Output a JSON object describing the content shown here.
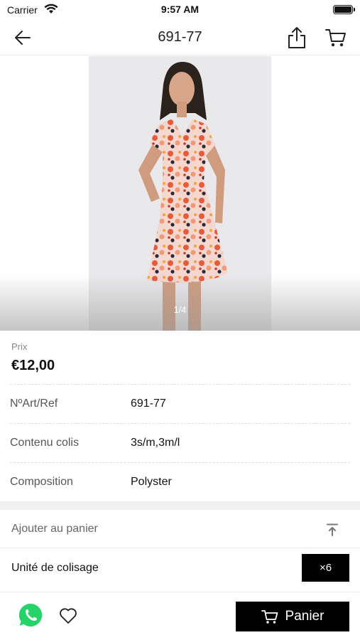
{
  "status_bar": {
    "carrier": "Carrier",
    "time": "9:57 AM"
  },
  "nav": {
    "title": "691-77",
    "icons": [
      "arrow-left-icon",
      "share-icon",
      "cart-icon"
    ]
  },
  "gallery": {
    "counter": "1/4"
  },
  "product": {
    "price_label": "Prix",
    "price": "€12,00",
    "specs": [
      {
        "label": "NºArt/Ref",
        "value": "691-77"
      },
      {
        "label": "Contenu colis",
        "value": "3s/m,3m/l"
      },
      {
        "label": "Composition",
        "value": "Polyster"
      }
    ]
  },
  "cart_section": {
    "add_label": "Ajouter au panier",
    "unit_label": "Unité de colisage",
    "unit_quantity": "×6"
  },
  "bottom_bar": {
    "cart_button_label": "Panier",
    "icons": [
      "whatsapp-icon",
      "heart-icon"
    ]
  },
  "colors": {
    "accent": "#000000",
    "whatsapp": "#25D366",
    "muted_text": "#888888"
  }
}
